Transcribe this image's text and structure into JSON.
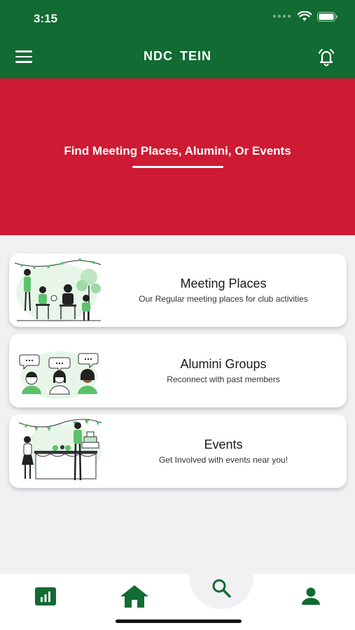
{
  "status_bar": {
    "time": "3:15"
  },
  "header": {
    "title": "NDC  TEIN"
  },
  "hero": {
    "title": "Find Meeting Places, Alumini, Or Events"
  },
  "cards": [
    {
      "title": "Meeting Places",
      "subtitle": "Our Regular meeting places for club activities"
    },
    {
      "title": "Alumini Groups",
      "subtitle": "Reconnect with past members"
    },
    {
      "title": "Events",
      "subtitle": "Get Involved with events near you!"
    }
  ],
  "bottom_nav": [
    {
      "icon": "stats-icon"
    },
    {
      "icon": "home-icon"
    },
    {
      "icon": "search-icon"
    },
    {
      "icon": "person-icon"
    }
  ],
  "colors": {
    "primary": "#116b32",
    "accent": "#ce1a33",
    "background": "#f1f1f3",
    "illustration_green": "#5cc26a"
  }
}
